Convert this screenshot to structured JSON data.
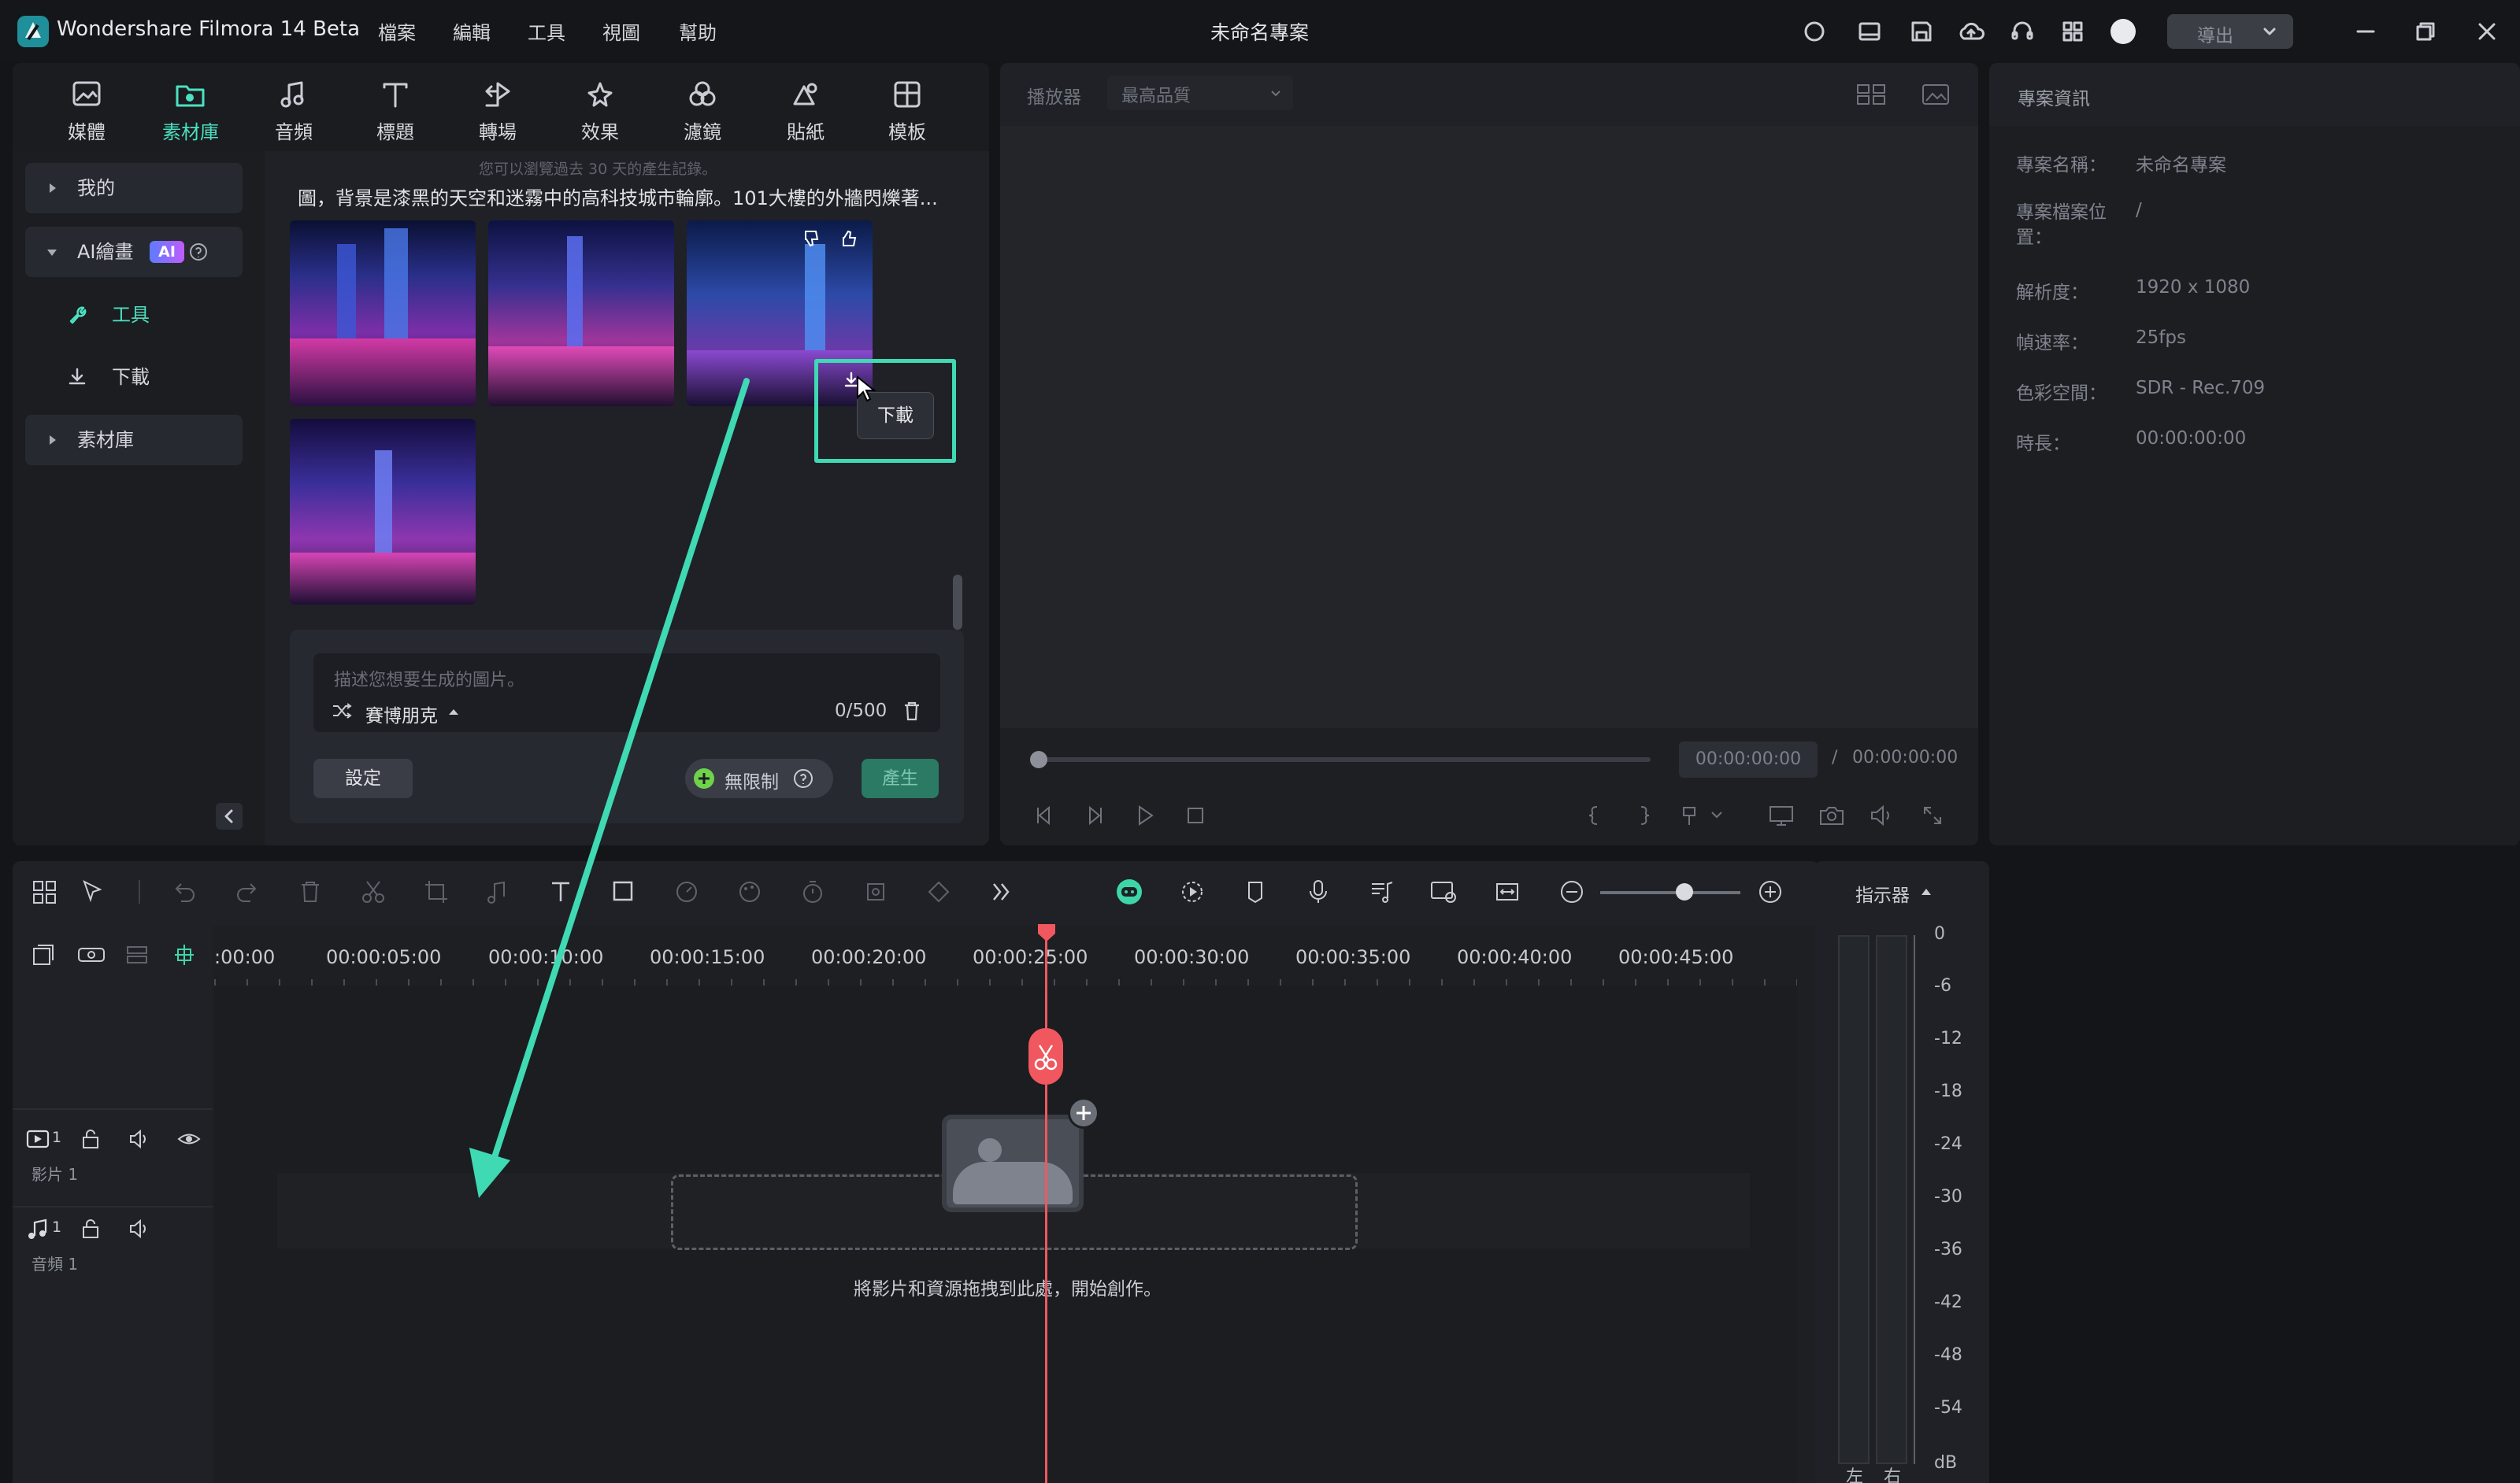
{
  "app": {
    "title": "Wondershare Filmora 14 Beta",
    "project_title": "未命名專案",
    "export_label": "導出"
  },
  "menu": [
    "檔案",
    "編輯",
    "工具",
    "視圖",
    "幫助"
  ],
  "media_tabs": [
    {
      "label": "媒體",
      "icon": "media-icon"
    },
    {
      "label": "素材庫",
      "icon": "stock-library-icon",
      "active": true
    },
    {
      "label": "音頻",
      "icon": "music-note-icon"
    },
    {
      "label": "標題",
      "icon": "title-text-icon"
    },
    {
      "label": "轉場",
      "icon": "transition-icon"
    },
    {
      "label": "效果",
      "icon": "effects-icon"
    },
    {
      "label": "濾鏡",
      "icon": "filters-icon"
    },
    {
      "label": "貼紙",
      "icon": "stickers-icon"
    },
    {
      "label": "模板",
      "icon": "templates-icon"
    }
  ],
  "sidebar": {
    "my": "我的",
    "ai_drawing": "AI繪畫",
    "ai_badge": "AI",
    "tool": "工具",
    "download": "下載",
    "stock": "素材庫"
  },
  "ai_panel": {
    "history_note": "您可以瀏覽過去 30 天的產生記錄。",
    "prompt_text": "圖，背景是漆黑的天空和迷霧中的高科技城市輪廓。101大樓的外牆閃爍著...",
    "tooltip": "下載",
    "input_placeholder": "描述您想要生成的圖片。",
    "style": "賽博朋克",
    "char_count": "0/500",
    "settings_label": "設定",
    "unlimited_label": "無限制",
    "generate_label": "產生"
  },
  "player": {
    "label": "播放器",
    "quality": "最高品質",
    "current_time": "00:00:00:00",
    "separator": "/",
    "total_time": "00:00:00:00"
  },
  "project_info": {
    "title": "專案資訊",
    "rows": [
      {
        "key": "專案名稱：",
        "value": "未命名專案"
      },
      {
        "key": "專案檔案位置：",
        "value": "/"
      },
      {
        "key": "解析度：",
        "value": "1920 x 1080"
      },
      {
        "key": "幀速率：",
        "value": "25fps"
      },
      {
        "key": "色彩空間：",
        "value": "SDR - Rec.709"
      },
      {
        "key": "時長：",
        "value": "00:00:00:00"
      }
    ]
  },
  "timeline": {
    "ruler": [
      ":00:00",
      "00:00:05:00",
      "00:00:10:00",
      "00:00:15:00",
      "00:00:20:00",
      "00:00:25:00",
      "00:00:30:00",
      "00:00:35:00",
      "00:00:40:00",
      "00:00:45:00"
    ],
    "video_track": "影片 1",
    "video_track_num": "1",
    "audio_track": "音頻 1",
    "audio_track_num": "1",
    "drop_hint": "將影片和資源拖拽到此處，開始創作。",
    "indicator_label": "指示器"
  },
  "meter": {
    "scale": [
      "0",
      "-6",
      "-12",
      "-18",
      "-24",
      "-30",
      "-36",
      "-42",
      "-48",
      "-54"
    ],
    "unit": "dB",
    "left": "左",
    "right": "右"
  },
  "colors": {
    "accent": "#4ce0c0",
    "playhead": "#f0575e",
    "annotation": "#3fd9b3"
  }
}
